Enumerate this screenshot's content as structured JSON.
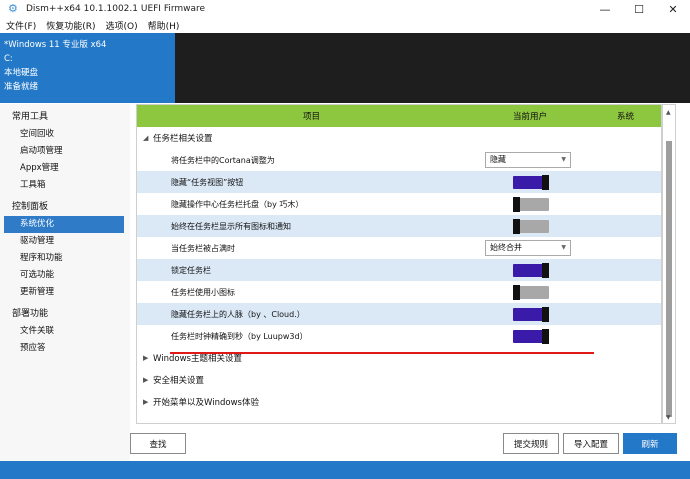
{
  "window": {
    "title": "Dism++x64 10.1.1002.1 UEFI Firmware",
    "minimize": "—",
    "maximize": "☐",
    "close": "✕"
  },
  "menu": [
    "文件(F)",
    "恢复功能(R)",
    "选项(O)",
    "帮助(H)"
  ],
  "header": {
    "os": "*Windows 11 专业版 x64",
    "drive": "C:",
    "disk": "本地硬盘",
    "status": "准备就绪"
  },
  "sidebar": {
    "groups": [
      {
        "label": "常用工具",
        "items": [
          "空间回收",
          "启动项管理",
          "Appx管理",
          "工具箱"
        ]
      },
      {
        "label": "控制面板",
        "items": [
          "系统优化",
          "驱动管理",
          "程序和功能",
          "可选功能",
          "更新管理"
        ]
      },
      {
        "label": "部署功能",
        "items": [
          "文件关联",
          "预应答"
        ]
      }
    ],
    "active": "系统优化"
  },
  "columns": {
    "item": "项目",
    "current_user": "当前用户",
    "system": "系统"
  },
  "sections": {
    "taskbar": "任务栏相关设置",
    "theme": "Windows主题相关设置",
    "security": "安全相关设置",
    "start": "开始菜单以及Windows体验"
  },
  "options": [
    {
      "label": "将任务栏中的Cortana调整为",
      "control": "select",
      "value": "隐藏"
    },
    {
      "label": "隐藏“任务视图”按钮",
      "control": "toggle",
      "on": true
    },
    {
      "label": "隐藏操作中心任务栏托盘（by 巧木）",
      "control": "toggle",
      "on": false
    },
    {
      "label": "始终在任务栏显示所有图标和通知",
      "control": "toggle",
      "on": false
    },
    {
      "label": "当任务栏被占满时",
      "control": "select",
      "value": "始终合并"
    },
    {
      "label": "锁定任务栏",
      "control": "toggle",
      "on": true
    },
    {
      "label": "任务栏使用小图标",
      "control": "toggle",
      "on": false
    },
    {
      "label": "隐藏任务栏上的人脉（by 、Cloud.）",
      "control": "toggle",
      "on": true
    },
    {
      "label": "任务栏时钟精确到秒（by Luupw3d）",
      "control": "toggle",
      "on": true
    }
  ],
  "buttons": {
    "find": "查找",
    "submit_rules": "提交规则",
    "import_config": "导入配置",
    "refresh": "刷新"
  },
  "colors": {
    "accent": "#2478c8",
    "header_green": "#8dc63f",
    "toggle_on": "#3a1aa8",
    "annotation": "#e01818"
  }
}
